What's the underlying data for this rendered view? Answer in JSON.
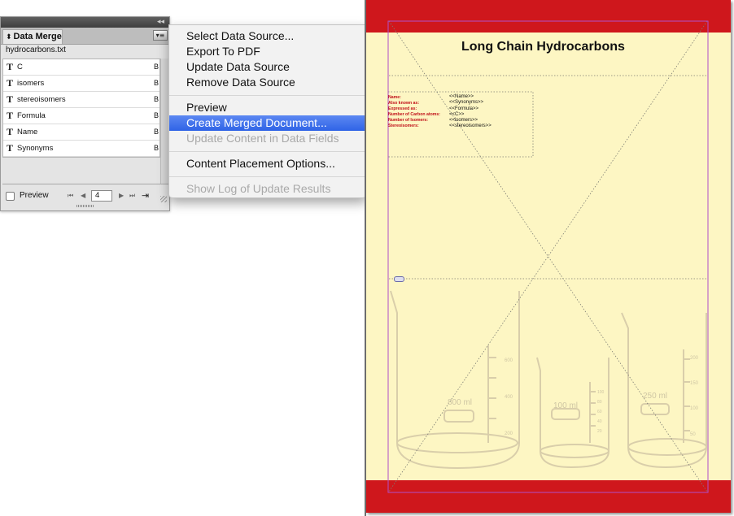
{
  "panel": {
    "collapse_glyph": "◂◂",
    "tab_label": "Data Merge",
    "updown_glyph": "⬍",
    "menu_glyph": "▾≡",
    "source_file": "hydrocarbons.txt",
    "fields": [
      {
        "name": "C",
        "type": "B",
        "icon": "text-field-icon",
        "icon_glyph": "T"
      },
      {
        "name": "isomers",
        "type": "B",
        "icon": "text-field-icon",
        "icon_glyph": "T"
      },
      {
        "name": "stereoisomers",
        "type": "B",
        "icon": "text-field-icon",
        "icon_glyph": "T"
      },
      {
        "name": "Formula",
        "type": "B",
        "icon": "text-field-icon",
        "icon_glyph": "T"
      },
      {
        "name": "Name",
        "type": "B",
        "icon": "text-field-icon",
        "icon_glyph": "T"
      },
      {
        "name": "Synonyms",
        "type": "B",
        "icon": "text-field-icon",
        "icon_glyph": "T"
      }
    ],
    "preview_label": "Preview",
    "preview_checked": false,
    "record_number": "4",
    "nav": {
      "first": "⏮",
      "prev": "◀",
      "next": "▶",
      "last": "⏭"
    },
    "merge_glyph": "⇥"
  },
  "menu": {
    "items": [
      {
        "label": "Select Data Source...",
        "state": "enabled"
      },
      {
        "label": "Export To PDF",
        "state": "enabled"
      },
      {
        "label": "Update Data Source",
        "state": "enabled"
      },
      {
        "label": "Remove Data Source",
        "state": "enabled"
      },
      {
        "label": "Preview",
        "state": "enabled"
      },
      {
        "label": "Create Merged Document...",
        "state": "selected"
      },
      {
        "label": "Update Content in Data Fields",
        "state": "disabled"
      },
      {
        "label": "Content Placement Options...",
        "state": "enabled"
      },
      {
        "label": "Show Log of Update Results",
        "state": "disabled"
      }
    ]
  },
  "document": {
    "title": "Long Chain Hydrocarbons",
    "field_labels": [
      "Name:",
      "Also known as:",
      "Expressed as:",
      "Number of Carbon atoms:",
      "Number of Isomers:",
      "Stereoisomers:"
    ],
    "placeholders": [
      "<<Name>>",
      "<<Synonyms>>",
      "<<Formula>>",
      "<<C>>",
      "<<isomers>>",
      "<<stereoisomers>>"
    ],
    "beaker_labels": [
      "800 ml",
      "100 ml",
      "250 ml"
    ],
    "scale_left": [
      "600",
      "400",
      "200"
    ],
    "scale_middle": [
      "100",
      "80",
      "60",
      "40",
      "20"
    ],
    "scale_right": [
      "200",
      "150",
      "100",
      "50"
    ]
  },
  "colors": {
    "page_background": "#fdf6c3",
    "band_red": "#cf171c",
    "label_red": "#c01018",
    "menu_highlight": "#3a6fe8",
    "margin_guide": "#b04fc8"
  }
}
